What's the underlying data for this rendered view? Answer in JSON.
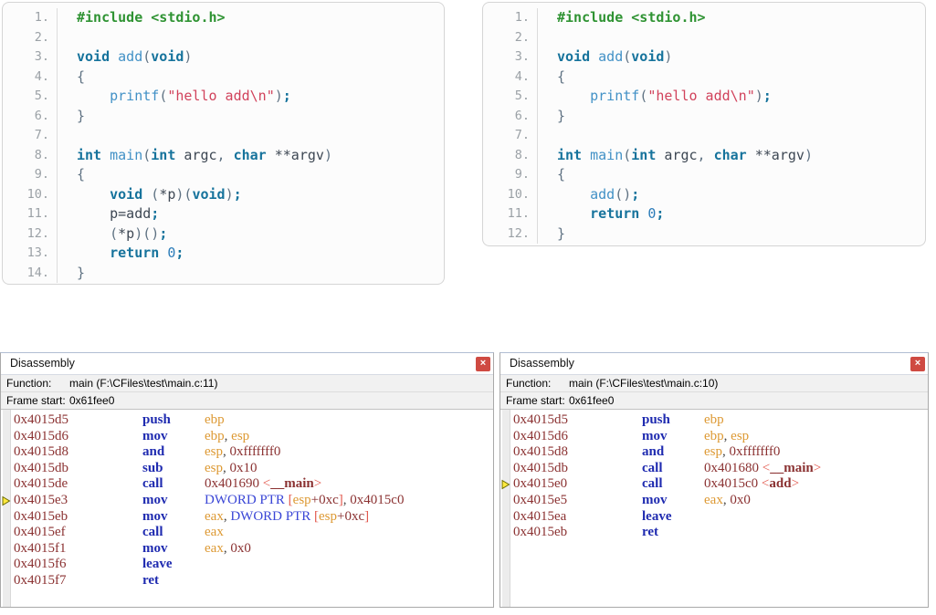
{
  "colors": {
    "code_green": "#2f9333",
    "code_keyword": "#16739c",
    "code_function": "#4291c6",
    "code_number": "#2b7cb9",
    "code_string": "#d1425b",
    "code_punct": "#5f7283",
    "code_plain": "#3d4753",
    "line_number": "#9ba1a6",
    "asm_address": "#8b3232",
    "asm_mnemonic": "#1f2bb0",
    "asm_register": "#dd9933",
    "asm_immediate": "#8b3232",
    "asm_memory": "#3a46d6",
    "asm_bracket": "#e2574c",
    "asm_punct": "#444444",
    "close_button_bg": "#cf4a42",
    "arrow_yellow": "#ffe93e"
  },
  "code_panels": [
    {
      "name": "function-pointer-version",
      "lines": [
        {
          "num": "1.",
          "tokens": [
            [
              "pre",
              "#include <stdio.h>"
            ]
          ]
        },
        {
          "num": "2.",
          "tokens": []
        },
        {
          "num": "3.",
          "tokens": [
            [
              "kwd",
              "void"
            ],
            [
              "pln",
              " "
            ],
            [
              "fn",
              "add"
            ],
            [
              "pun",
              "("
            ],
            [
              "kwd",
              "void"
            ],
            [
              "pun",
              ")"
            ]
          ]
        },
        {
          "num": "4.",
          "tokens": [
            [
              "pun",
              "{"
            ]
          ]
        },
        {
          "num": "5.",
          "tokens": [
            [
              "pln",
              "    "
            ],
            [
              "fn",
              "printf"
            ],
            [
              "pun",
              "("
            ],
            [
              "str",
              "\"hello add\\n\""
            ],
            [
              "pun",
              ")"
            ],
            [
              "kwd",
              ";"
            ]
          ]
        },
        {
          "num": "6.",
          "tokens": [
            [
              "pun",
              "}"
            ]
          ]
        },
        {
          "num": "7.",
          "tokens": []
        },
        {
          "num": "8.",
          "tokens": [
            [
              "kwd",
              "int"
            ],
            [
              "pln",
              " "
            ],
            [
              "fn",
              "main"
            ],
            [
              "pun",
              "("
            ],
            [
              "kwd",
              "int"
            ],
            [
              "pln",
              " argc"
            ],
            [
              "pun",
              ","
            ],
            [
              "pln",
              " "
            ],
            [
              "kwd",
              "char"
            ],
            [
              "pln",
              " **argv"
            ],
            [
              "pun",
              ")"
            ]
          ]
        },
        {
          "num": "9.",
          "tokens": [
            [
              "pun",
              "{"
            ]
          ]
        },
        {
          "num": "10.",
          "tokens": [
            [
              "pln",
              "    "
            ],
            [
              "kwd",
              "void"
            ],
            [
              "pln",
              " "
            ],
            [
              "pun",
              "("
            ],
            [
              "pln",
              "*p"
            ],
            [
              "pun",
              ")("
            ],
            [
              "kwd",
              "void"
            ],
            [
              "pun",
              ")"
            ],
            [
              "kwd",
              ";"
            ]
          ]
        },
        {
          "num": "11.",
          "tokens": [
            [
              "pln",
              "    p=add"
            ],
            [
              "kwd",
              ";"
            ]
          ]
        },
        {
          "num": "12.",
          "tokens": [
            [
              "pln",
              "    "
            ],
            [
              "pun",
              "("
            ],
            [
              "pln",
              "*p"
            ],
            [
              "pun",
              ")()"
            ],
            [
              "kwd",
              ";"
            ]
          ]
        },
        {
          "num": "13.",
          "tokens": [
            [
              "pln",
              "    "
            ],
            [
              "kwd",
              "return"
            ],
            [
              "pln",
              " "
            ],
            [
              "num",
              "0"
            ],
            [
              "kwd",
              ";"
            ]
          ]
        },
        {
          "num": "14.",
          "tokens": [
            [
              "pun",
              "}"
            ]
          ]
        }
      ]
    },
    {
      "name": "direct-call-version",
      "lines": [
        {
          "num": "1.",
          "tokens": [
            [
              "pre",
              "#include <stdio.h>"
            ]
          ]
        },
        {
          "num": "2.",
          "tokens": []
        },
        {
          "num": "3.",
          "tokens": [
            [
              "kwd",
              "void"
            ],
            [
              "pln",
              " "
            ],
            [
              "fn",
              "add"
            ],
            [
              "pun",
              "("
            ],
            [
              "kwd",
              "void"
            ],
            [
              "pun",
              ")"
            ]
          ]
        },
        {
          "num": "4.",
          "tokens": [
            [
              "pun",
              "{"
            ]
          ]
        },
        {
          "num": "5.",
          "tokens": [
            [
              "pln",
              "    "
            ],
            [
              "fn",
              "printf"
            ],
            [
              "pun",
              "("
            ],
            [
              "str",
              "\"hello add\\n\""
            ],
            [
              "pun",
              ")"
            ],
            [
              "kwd",
              ";"
            ]
          ]
        },
        {
          "num": "6.",
          "tokens": [
            [
              "pun",
              "}"
            ]
          ]
        },
        {
          "num": "7.",
          "tokens": []
        },
        {
          "num": "8.",
          "tokens": [
            [
              "kwd",
              "int"
            ],
            [
              "pln",
              " "
            ],
            [
              "fn",
              "main"
            ],
            [
              "pun",
              "("
            ],
            [
              "kwd",
              "int"
            ],
            [
              "pln",
              " argc"
            ],
            [
              "pun",
              ","
            ],
            [
              "pln",
              " "
            ],
            [
              "kwd",
              "char"
            ],
            [
              "pln",
              " **argv"
            ],
            [
              "pun",
              ")"
            ]
          ]
        },
        {
          "num": "9.",
          "tokens": [
            [
              "pun",
              "{"
            ]
          ]
        },
        {
          "num": "10.",
          "tokens": [
            [
              "pln",
              "    "
            ],
            [
              "fn",
              "add"
            ],
            [
              "pun",
              "()"
            ],
            [
              "kwd",
              ";"
            ]
          ]
        },
        {
          "num": "11.",
          "tokens": [
            [
              "pln",
              "    "
            ],
            [
              "kwd",
              "return"
            ],
            [
              "pln",
              " "
            ],
            [
              "num",
              "0"
            ],
            [
              "kwd",
              ";"
            ]
          ]
        },
        {
          "num": "12.",
          "tokens": [
            [
              "pun",
              "}"
            ]
          ]
        }
      ]
    }
  ],
  "disasm_panels": [
    {
      "title": "Disassembly",
      "close_label": "×",
      "function_label": "Function:",
      "function_value": "main (F:\\CFiles\\test\\main.c:11)",
      "frame_label": "Frame start:",
      "frame_value": "0x61fee0",
      "current_address": "0x4015e3",
      "rows": [
        {
          "addr": "0x4015d5",
          "mnemonic": "push",
          "operands": [
            [
              "reg",
              "ebp"
            ]
          ]
        },
        {
          "addr": "0x4015d6",
          "mnemonic": "mov",
          "operands": [
            [
              "reg",
              "ebp"
            ],
            [
              "pun",
              ", "
            ],
            [
              "reg",
              "esp"
            ]
          ]
        },
        {
          "addr": "0x4015d8",
          "mnemonic": "and",
          "operands": [
            [
              "reg",
              "esp"
            ],
            [
              "pun",
              ", "
            ],
            [
              "imm",
              "0xfffffff0"
            ]
          ]
        },
        {
          "addr": "0x4015db",
          "mnemonic": "sub",
          "operands": [
            [
              "reg",
              "esp"
            ],
            [
              "pun",
              ", "
            ],
            [
              "imm",
              "0x10"
            ]
          ]
        },
        {
          "addr": "0x4015de",
          "mnemonic": "call",
          "operands": [
            [
              "imm",
              "0x401690"
            ],
            [
              "pln",
              " "
            ],
            [
              "brk",
              "<"
            ],
            [
              "sym",
              "__main"
            ],
            [
              "brk",
              ">"
            ]
          ]
        },
        {
          "addr": "0x4015e3",
          "mnemonic": "mov",
          "operands": [
            [
              "mem",
              "DWORD PTR"
            ],
            [
              "pln",
              " "
            ],
            [
              "brk",
              "["
            ],
            [
              "reg",
              "esp"
            ],
            [
              "imm",
              "+0xc"
            ],
            [
              "brk",
              "]"
            ],
            [
              "pun",
              ", "
            ],
            [
              "imm",
              "0x4015c0"
            ]
          ]
        },
        {
          "addr": "0x4015eb",
          "mnemonic": "mov",
          "operands": [
            [
              "reg",
              "eax"
            ],
            [
              "pun",
              ", "
            ],
            [
              "mem",
              "DWORD PTR"
            ],
            [
              "pln",
              " "
            ],
            [
              "brk",
              "["
            ],
            [
              "reg",
              "esp"
            ],
            [
              "imm",
              "+0xc"
            ],
            [
              "brk",
              "]"
            ]
          ]
        },
        {
          "addr": "0x4015ef",
          "mnemonic": "call",
          "operands": [
            [
              "reg",
              "eax"
            ]
          ]
        },
        {
          "addr": "0x4015f1",
          "mnemonic": "mov",
          "operands": [
            [
              "reg",
              "eax"
            ],
            [
              "pun",
              ", "
            ],
            [
              "imm",
              "0x0"
            ]
          ]
        },
        {
          "addr": "0x4015f6",
          "mnemonic": "leave",
          "operands": []
        },
        {
          "addr": "0x4015f7",
          "mnemonic": "ret",
          "operands": []
        }
      ]
    },
    {
      "title": "Disassembly",
      "close_label": "×",
      "function_label": "Function:",
      "function_value": "main (F:\\CFiles\\test\\main.c:10)",
      "frame_label": "Frame start:",
      "frame_value": "0x61fee0",
      "current_address": "0x4015e0",
      "rows": [
        {
          "addr": "0x4015d5",
          "mnemonic": "push",
          "operands": [
            [
              "reg",
              "ebp"
            ]
          ]
        },
        {
          "addr": "0x4015d6",
          "mnemonic": "mov",
          "operands": [
            [
              "reg",
              "ebp"
            ],
            [
              "pun",
              ", "
            ],
            [
              "reg",
              "esp"
            ]
          ]
        },
        {
          "addr": "0x4015d8",
          "mnemonic": "and",
          "operands": [
            [
              "reg",
              "esp"
            ],
            [
              "pun",
              ", "
            ],
            [
              "imm",
              "0xfffffff0"
            ]
          ]
        },
        {
          "addr": "0x4015db",
          "mnemonic": "call",
          "operands": [
            [
              "imm",
              "0x401680"
            ],
            [
              "pln",
              " "
            ],
            [
              "brk",
              "<"
            ],
            [
              "sym",
              "__main"
            ],
            [
              "brk",
              ">"
            ]
          ]
        },
        {
          "addr": "0x4015e0",
          "mnemonic": "call",
          "operands": [
            [
              "imm",
              "0x4015c0"
            ],
            [
              "pln",
              " "
            ],
            [
              "brk",
              "<"
            ],
            [
              "sym",
              "add"
            ],
            [
              "brk",
              ">"
            ]
          ]
        },
        {
          "addr": "0x4015e5",
          "mnemonic": "mov",
          "operands": [
            [
              "reg",
              "eax"
            ],
            [
              "pun",
              ", "
            ],
            [
              "imm",
              "0x0"
            ]
          ]
        },
        {
          "addr": "0x4015ea",
          "mnemonic": "leave",
          "operands": []
        },
        {
          "addr": "0x4015eb",
          "mnemonic": "ret",
          "operands": []
        }
      ]
    }
  ]
}
